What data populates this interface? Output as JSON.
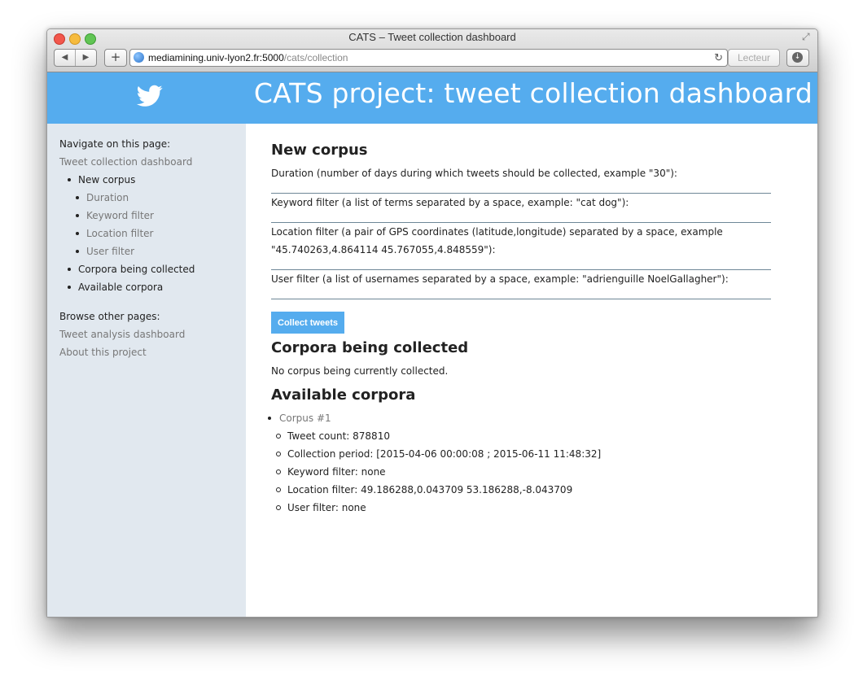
{
  "browser": {
    "window_title": "CATS – Tweet collection dashboard",
    "url_host": "mediamining.univ-lyon2.fr:5000",
    "url_path": "/cats/collection",
    "reader_label": "Lecteur"
  },
  "banner": {
    "title": "CATS project: tweet collection dashboard",
    "color": "#55acee"
  },
  "sidebar": {
    "navigate_heading": "Navigate on this page:",
    "root_link": "Tweet collection dashboard",
    "items": [
      {
        "label": "New corpus"
      },
      {
        "label": "Duration"
      },
      {
        "label": "Keyword filter"
      },
      {
        "label": "Location filter"
      },
      {
        "label": "User filter"
      },
      {
        "label": "Corpora being collected"
      },
      {
        "label": "Available corpora"
      }
    ],
    "browse_heading": "Browse other pages:",
    "other_pages": [
      {
        "label": "Tweet analysis dashboard"
      },
      {
        "label": "About this project"
      }
    ]
  },
  "main": {
    "new_corpus_title": "New corpus",
    "duration_label": "Duration (number of days during which tweets should be collected, example \"30\"):",
    "keyword_label": "Keyword filter (a list of terms separated by a space, example: \"cat dog\"):",
    "location_label_1": "Location filter (a pair of GPS coordinates (latitude,longitude) separated by a space, example",
    "location_label_2": "\"45.740263,4.864114 45.767055,4.848559\"):",
    "user_label": "User filter (a list of usernames separated by a space, example: \"adrienguille NoelGallagher\"):",
    "collect_button": "Collect tweets",
    "being_collected_title": "Corpora being collected",
    "no_corpus_text": "No corpus being currently collected.",
    "available_title": "Available corpora",
    "corpora": [
      {
        "name": "Corpus #1",
        "tweet_count": "Tweet count: 878810",
        "collection_period": "Collection period: [2015-04-06 00:00:08 ; 2015-06-11 11:48:32]",
        "keyword_filter": "Keyword filter: none",
        "location_filter": "Location filter: 49.186288,0.043709 53.186288,-8.043709",
        "user_filter": "User filter: none"
      }
    ]
  }
}
